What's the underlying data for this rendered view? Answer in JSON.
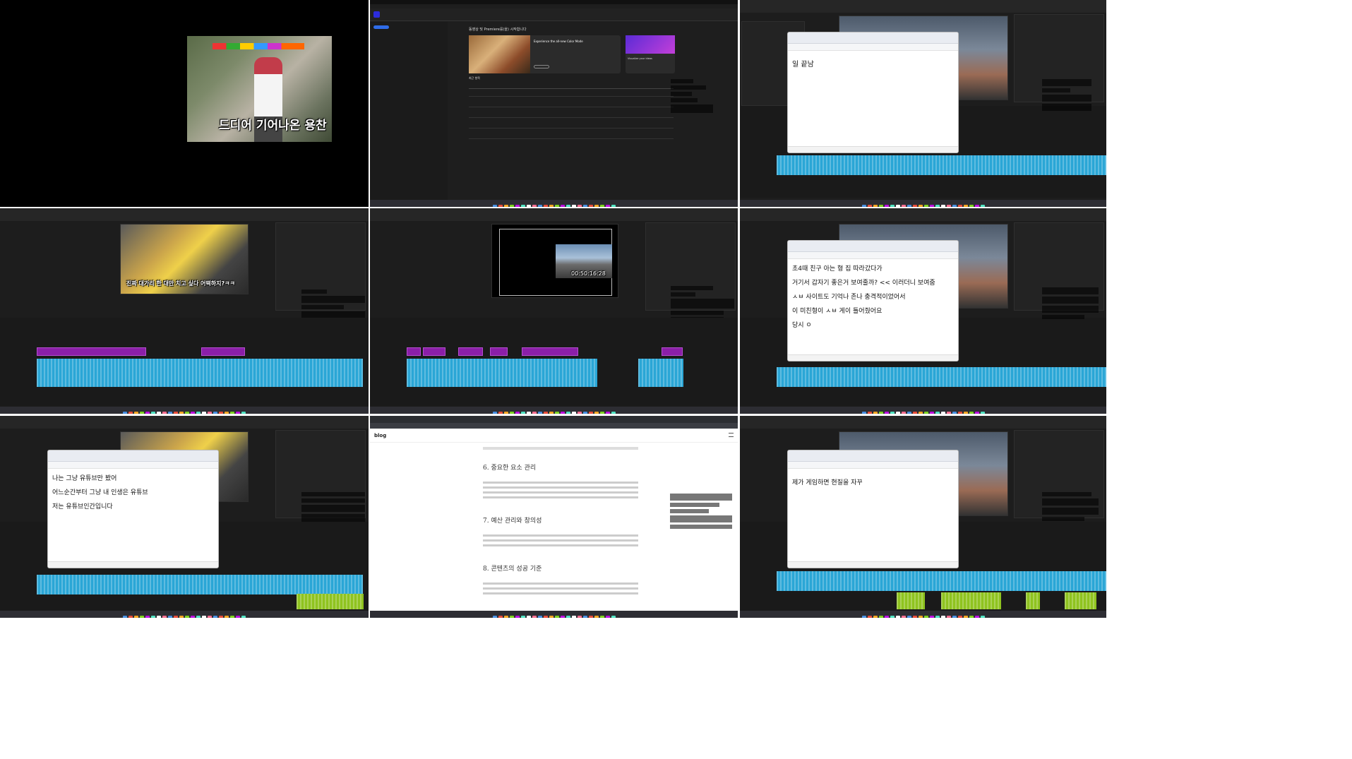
{
  "tile1": {
    "subtitle": "드디어 기어나온 용찬"
  },
  "tile2": {
    "header": "동영상 및 Premiere를(을) 시작합니다",
    "featured_title": "Experience the all-new Color Mode",
    "visualize_label": "Visualize your ideas",
    "recent_header": "최근 항목"
  },
  "tile3": {
    "note_text": "일 끝남"
  },
  "tile4": {
    "subtitle": "진짜 대가리 한 대만 치고 싶다 어떡하지?ㅋㅋ"
  },
  "tile5": {
    "timecode": "00:50:16:28"
  },
  "tile6": {
    "lines": [
      "초4때 친구 아는 형 집 따라갔다가",
      "거기서 갑자기 좋은거 보여줄까? << 이러더니 보여줌",
      "ㅅㅂ 사이트도 기억나 존나 충격적이었어서",
      "이 미친형이 ㅅㅂ 게이 틀어줬어요",
      "당시 ㅇ"
    ]
  },
  "tile7": {
    "lines": [
      "나는 그냥 유튜브만 봤어",
      "어느순간부터 그냥 내 인생은 유튜브",
      "저는 유튜브인간입니다"
    ]
  },
  "tile8": {
    "brand": "blog",
    "headings": [
      "6. 중요한 요소 관리",
      "7. 예산 관리와 창의성",
      "8. 콘텐츠의 성공 기준"
    ]
  },
  "tile9": {
    "note_text": "제가 게임하면 현질을 자꾸"
  },
  "colors": {
    "purple_clip": "#8b1fa8",
    "audio_clip": "#2aa6d6",
    "green_audio": "#8fc31f"
  }
}
